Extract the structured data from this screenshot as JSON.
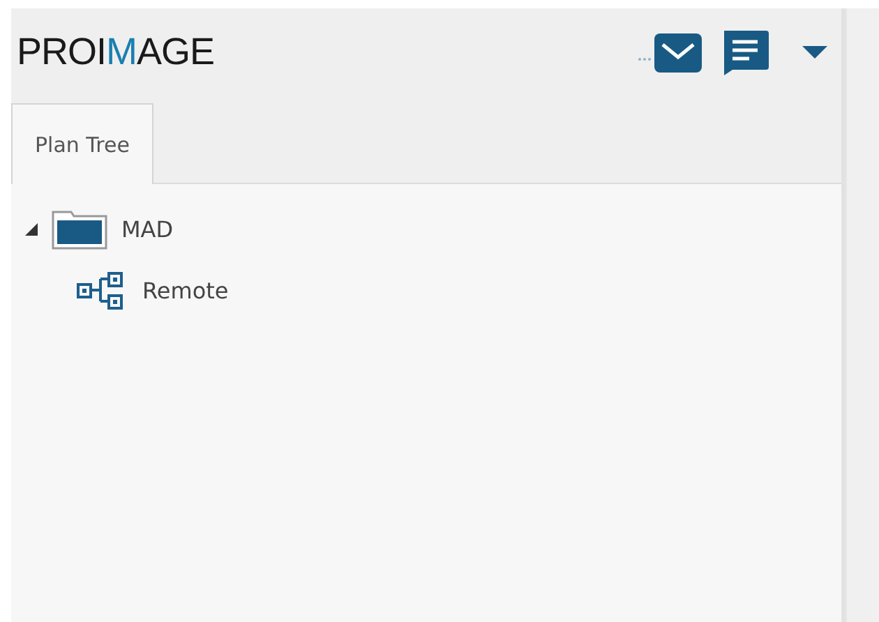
{
  "logo": {
    "segments": [
      {
        "text": "PROI",
        "accent": false
      },
      {
        "text": "M",
        "accent": true
      },
      {
        "text": "AGE",
        "accent": false
      }
    ]
  },
  "tabs": [
    {
      "label": "Plan Tree",
      "selected": true
    }
  ],
  "tree": [
    {
      "label": "MAD",
      "kind": "folder",
      "expanded": true,
      "children": [
        {
          "label": "Remote",
          "kind": "network"
        }
      ]
    }
  ]
}
